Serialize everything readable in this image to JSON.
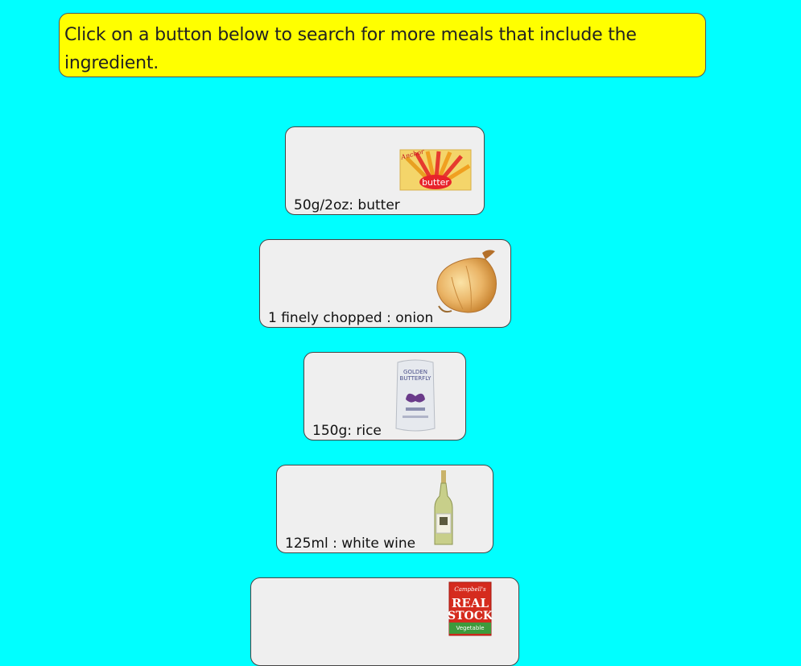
{
  "banner": {
    "text": "Click on a button below to search for more meals that include the ingredient."
  },
  "ingredients": [
    {
      "label": "50g/2oz: butter",
      "image_name": "butter-image"
    },
    {
      "label": "1 finely chopped : onion",
      "image_name": "onion-image"
    },
    {
      "label": "150g: rice",
      "image_name": "rice-image"
    },
    {
      "label": "125ml : white wine",
      "image_name": "white-wine-image"
    },
    {
      "label": "",
      "image_name": "vegetable-stock-image"
    }
  ],
  "product_text": {
    "butter_brand": "Anchor",
    "butter_word": "butter",
    "rice_brand_line1": "GOLDEN",
    "rice_brand_line2": "BUTTERFLY",
    "stock_brand": "Campbell's",
    "stock_line1": "REAL",
    "stock_line2": "STOCK",
    "stock_line3": "Vegetable"
  }
}
